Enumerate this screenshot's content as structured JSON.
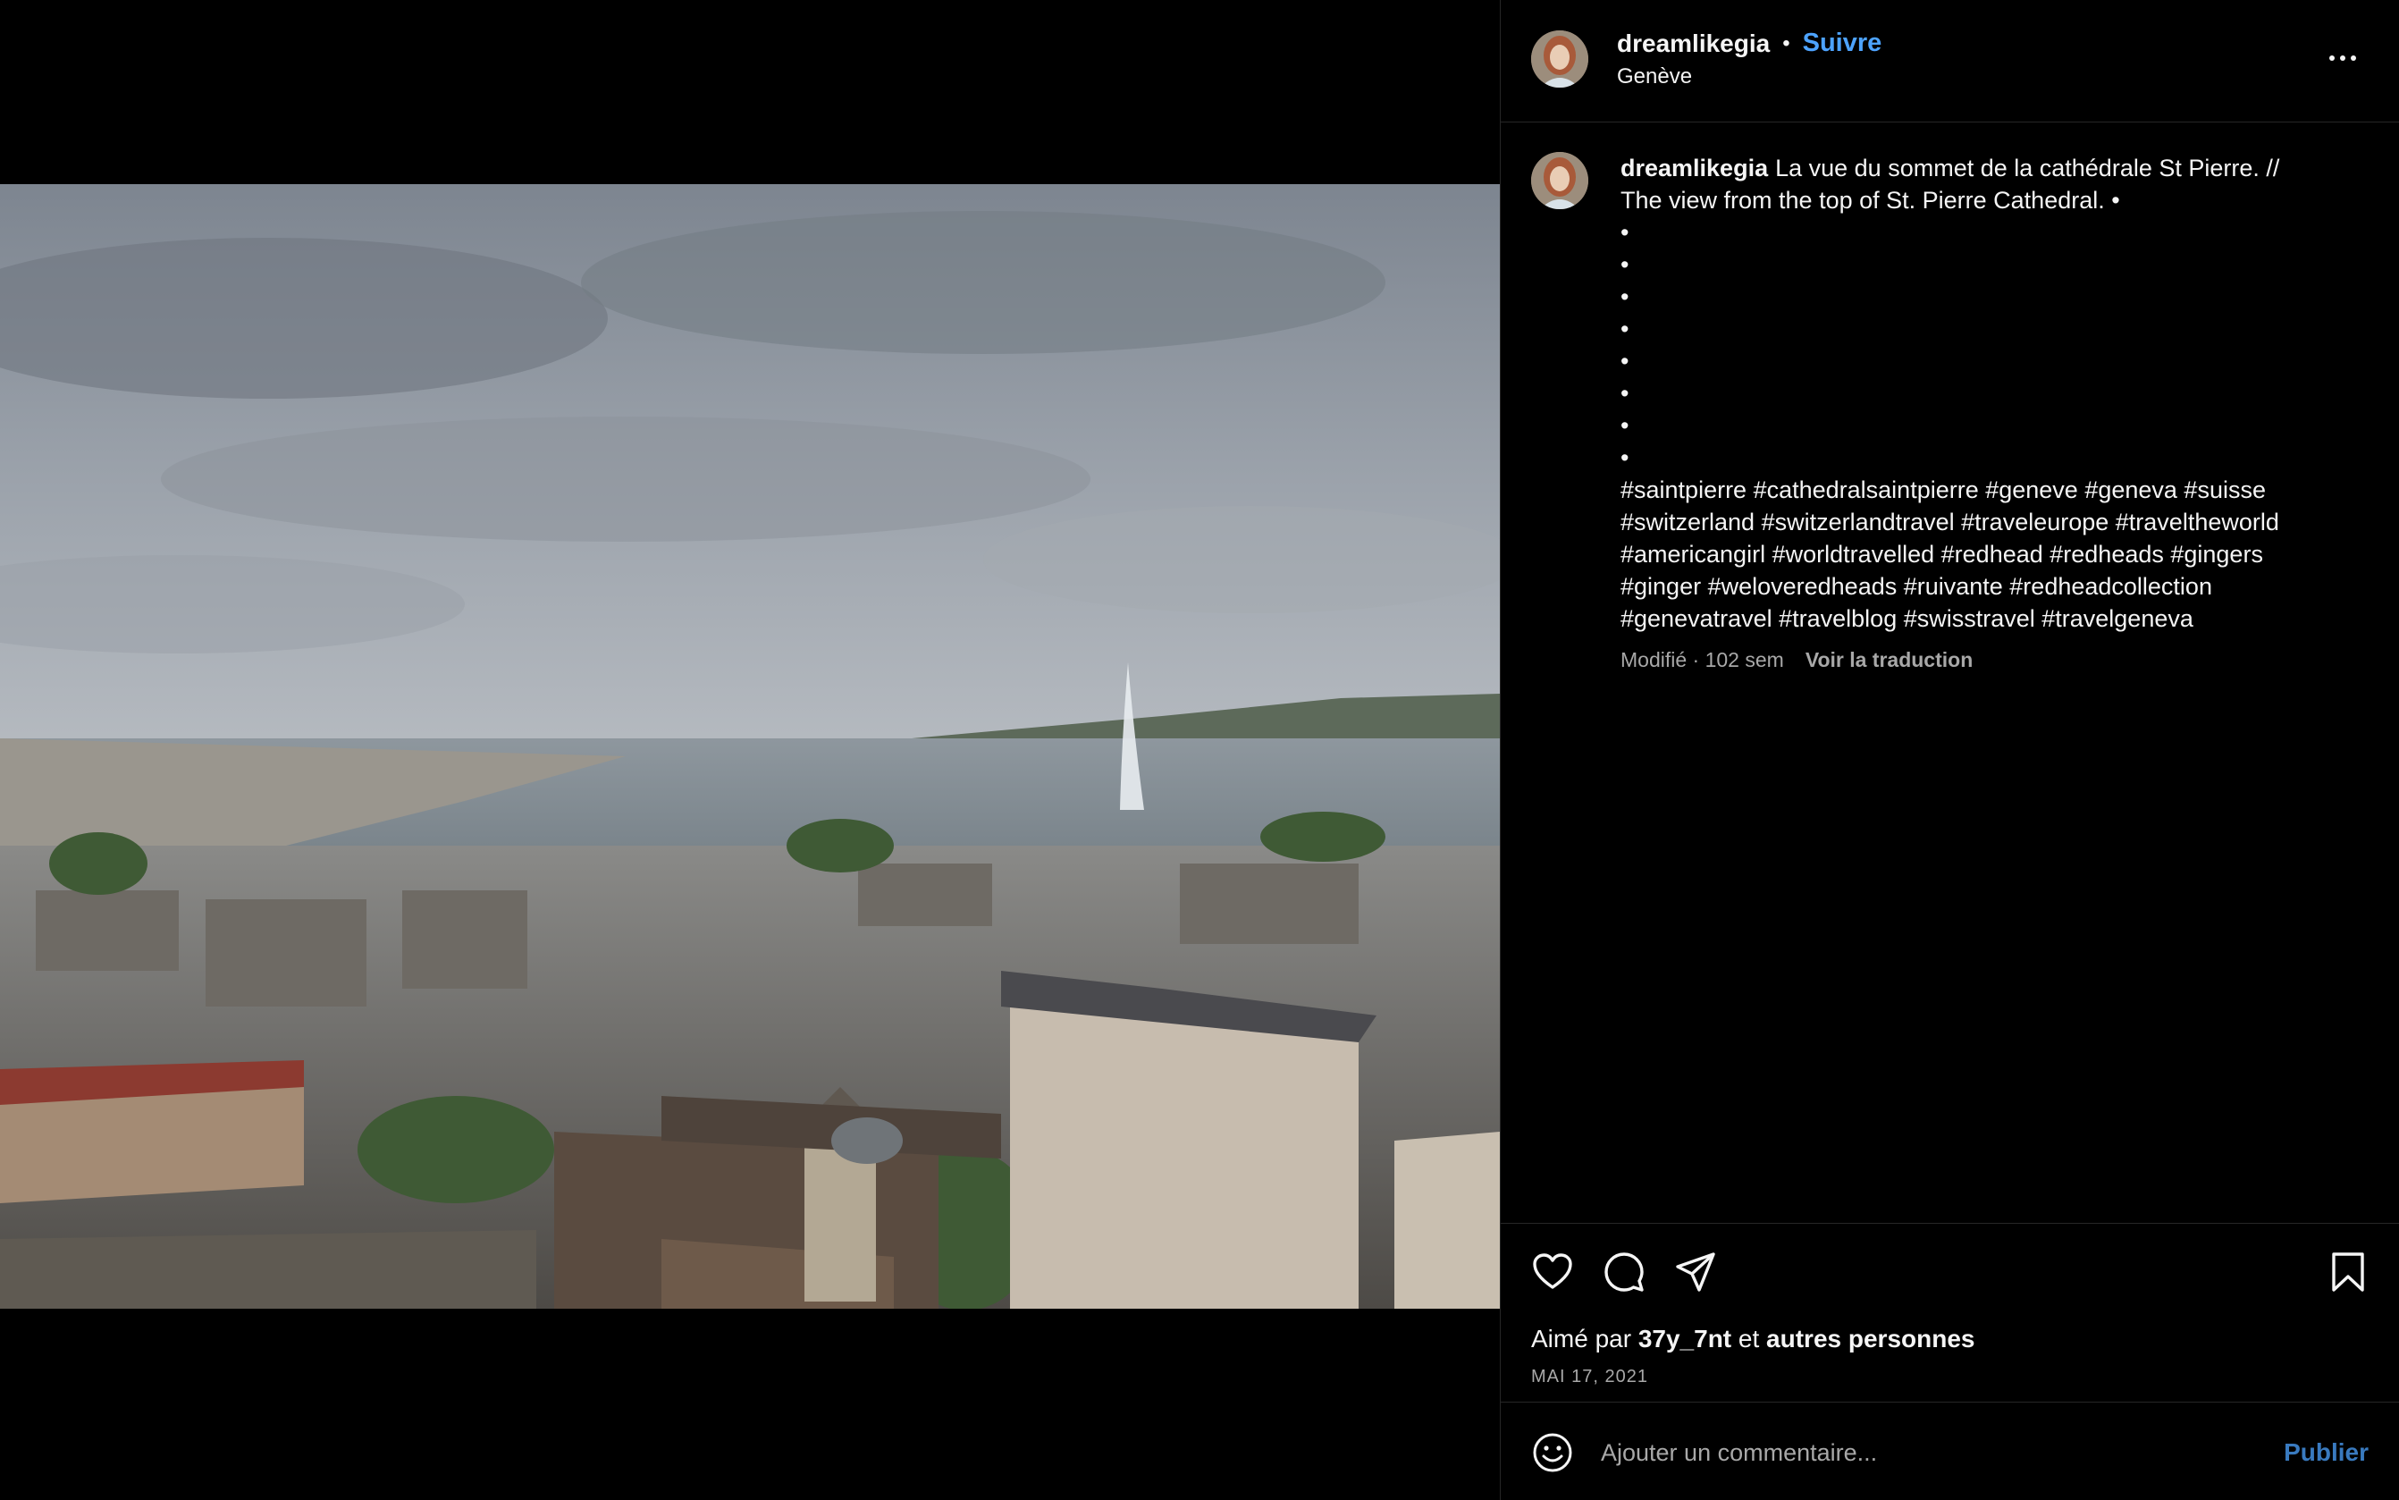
{
  "post": {
    "username": "dreamlikegia",
    "separator": "•",
    "follow_label": "Suivre",
    "location": "Genève",
    "more_icon": "more-horizontal-icon"
  },
  "caption": {
    "username": "dreamlikegia",
    "text_line1": "La vue du sommet de la cathédrale St Pierre. //",
    "text_line2": "The view from the top of St. Pierre Cathedral. •",
    "bullets": [
      "•",
      "•",
      "•",
      "•",
      "•",
      "•",
      "•",
      "•"
    ],
    "hashtags": [
      "#saintpierre #cathedralsaintpierre #geneve #geneva #suisse",
      "#switzerland #switzerlandtravel #traveleurope #traveltheworld",
      "#americangirl #worldtravelled #redhead #redheads #gingers",
      "#ginger #weloveredheads #ruivante #redheadcollection",
      "#genevatravel #travelblog #swisstravel #travelgeneva"
    ],
    "meta_modified": "Modifié · 102 sem",
    "translate_label": "Voir la traduction"
  },
  "actions": {
    "like_icon": "heart-icon",
    "comment_icon": "comment-bubble-icon",
    "share_icon": "paper-plane-icon",
    "save_icon": "bookmark-icon",
    "likes_prefix": "Aimé par",
    "likes_user": "37y_7nt",
    "likes_and": "et",
    "likes_others": "autres personnes",
    "date": "MAI 17, 2021"
  },
  "comment": {
    "emoji_icon": "emoji-smiley-icon",
    "placeholder": "Ajouter un commentaire...",
    "value": "",
    "publish_label": "Publier"
  },
  "colors": {
    "background": "#000000",
    "accent": "#4da3ff",
    "muted": "#a8a8a8",
    "divider": "#262626"
  }
}
